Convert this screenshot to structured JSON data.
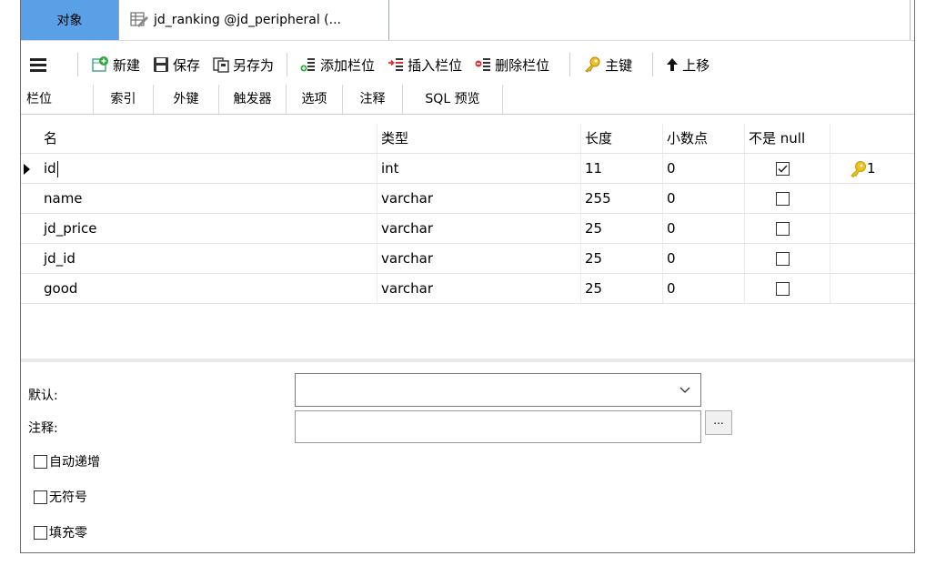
{
  "window": {
    "tab_objects": "对象",
    "tab_active_title": "jd_ranking @jd_peripheral (..."
  },
  "toolbar": {
    "new_label": "新建",
    "save_label": "保存",
    "save_as_label": "另存为",
    "add_field_label": "添加栏位",
    "insert_field_label": "插入栏位",
    "delete_field_label": "删除栏位",
    "primary_key_label": "主键",
    "move_up_label": "上移"
  },
  "subtabs": [
    "栏位",
    "索引",
    "外键",
    "触发器",
    "选项",
    "注释",
    "SQL 预览"
  ],
  "grid": {
    "headers": {
      "name": "名",
      "type": "类型",
      "length": "长度",
      "decimal": "小数点",
      "not_null": "不是 null"
    },
    "rows": [
      {
        "name": "id",
        "type": "int",
        "length": "11",
        "decimal": "0",
        "not_null": true,
        "key": "1"
      },
      {
        "name": "name",
        "type": "varchar",
        "length": "255",
        "decimal": "0",
        "not_null": false,
        "key": ""
      },
      {
        "name": "jd_price",
        "type": "varchar",
        "length": "25",
        "decimal": "0",
        "not_null": false,
        "key": ""
      },
      {
        "name": "jd_id",
        "type": "varchar",
        "length": "25",
        "decimal": "0",
        "not_null": false,
        "key": ""
      },
      {
        "name": "good",
        "type": "varchar",
        "length": "25",
        "decimal": "0",
        "not_null": false,
        "key": ""
      }
    ]
  },
  "props": {
    "default_label": "默认:",
    "comment_label": "注释:",
    "dots_label": "...",
    "auto_increment_label": "自动递增",
    "unsigned_label": "无符号",
    "zerofill_label": "填充零"
  },
  "colors": {
    "accent_tab": "#5aa0e6",
    "key_icon": "#e6b800"
  }
}
